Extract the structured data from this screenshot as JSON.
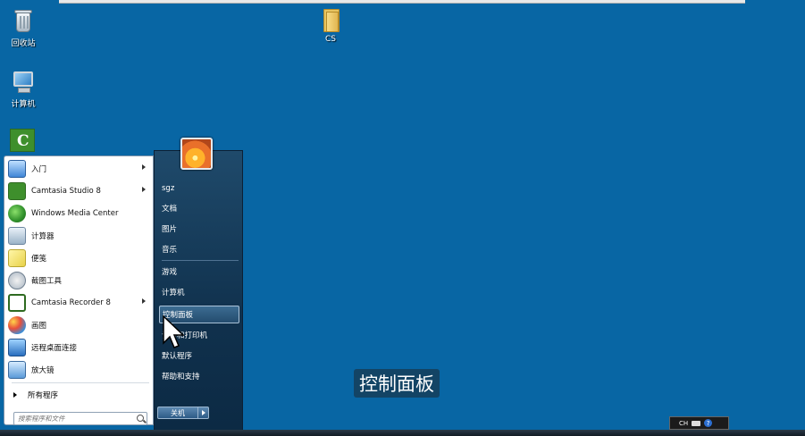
{
  "desktop": {
    "icons": [
      {
        "label": "回收站",
        "icon": "recycle-bin-icon"
      },
      {
        "label": "计算机",
        "icon": "computer-icon"
      },
      {
        "label": "CS",
        "icon": "folder-icon"
      },
      {
        "label": "",
        "icon": "camtasia-icon"
      }
    ]
  },
  "start_menu": {
    "programs": [
      {
        "label": "入门",
        "icon": "getting-started-icon",
        "submenu": true
      },
      {
        "label": "Camtasia Studio 8",
        "icon": "camtasia-studio-icon",
        "submenu": true
      },
      {
        "label": "Windows Media Center",
        "icon": "media-center-icon",
        "submenu": false
      },
      {
        "label": "计算器",
        "icon": "calculator-icon",
        "submenu": false
      },
      {
        "label": "便笺",
        "icon": "sticky-notes-icon",
        "submenu": false
      },
      {
        "label": "截图工具",
        "icon": "snipping-tool-icon",
        "submenu": false
      },
      {
        "label": "Camtasia Recorder 8",
        "icon": "camtasia-recorder-icon",
        "submenu": true
      },
      {
        "label": "画图",
        "icon": "paint-icon",
        "submenu": false
      },
      {
        "label": "远程桌面连接",
        "icon": "remote-desktop-icon",
        "submenu": false
      },
      {
        "label": "放大镜",
        "icon": "magnifier-icon",
        "submenu": false
      }
    ],
    "all_programs": "所有程序",
    "search_placeholder": "搜索程序和文件",
    "right_items": [
      {
        "label": "sgz"
      },
      {
        "label": "文档"
      },
      {
        "label": "图片"
      },
      {
        "label": "音乐"
      },
      {
        "label": "游戏"
      },
      {
        "label": "计算机"
      },
      {
        "label": "控制面板",
        "highlighted": true
      },
      {
        "label": "设备和打印机"
      },
      {
        "label": "默认程序"
      },
      {
        "label": "帮助和支持"
      }
    ],
    "shutdown_label": "关机"
  },
  "caption": "控制面板",
  "tray": {
    "language": "CH"
  },
  "colors": {
    "desktop": "#0866a4",
    "menu_right": "#10314d",
    "highlight": "#3c6c92"
  }
}
